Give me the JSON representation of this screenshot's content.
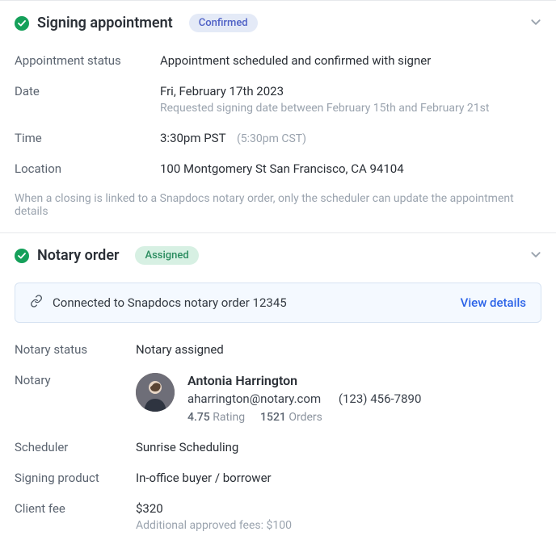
{
  "appointment": {
    "title": "Signing appointment",
    "badge": "Confirmed",
    "status_label": "Appointment status",
    "status_value": "Appointment scheduled and confirmed with signer",
    "date_label": "Date",
    "date_value": "Fri, February 17th 2023",
    "date_note": "Requested signing date between February 15th and February 21st",
    "time_label": "Time",
    "time_value": "3:30pm PST",
    "time_alt": "(5:30pm CST)",
    "location_label": "Location",
    "location_value": "100 Montgomery St San Francisco, CA 94104",
    "footer_note": "When a closing is linked to a Snapdocs notary order, only the scheduler can update the appointment details"
  },
  "notaryOrder": {
    "title": "Notary order",
    "badge": "Assigned",
    "banner_text": "Connected to Snapdocs notary order 12345",
    "banner_link": "View details",
    "status_label": "Notary status",
    "status_value": "Notary assigned",
    "notary_label": "Notary",
    "notary": {
      "name": "Antonia Harrington",
      "email": "aharrington@notary.com",
      "phone": "(123) 456-7890",
      "rating_value": "4.75",
      "rating_label": "Rating",
      "orders_value": "1521",
      "orders_label": "Orders"
    },
    "scheduler_label": "Scheduler",
    "scheduler_value": "Sunrise Scheduling",
    "product_label": "Signing product",
    "product_value": "In-office buyer / borrower",
    "fee_label": "Client fee",
    "fee_value": "$320",
    "fee_note": "Additional approved fees: $100"
  }
}
